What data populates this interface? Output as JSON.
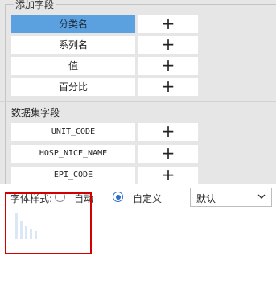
{
  "add_field": {
    "legend": "添加字段",
    "rows": [
      {
        "label": "分类名",
        "add": "+"
      },
      {
        "label": "系列名",
        "add": "+"
      },
      {
        "label": "值",
        "add": "+"
      },
      {
        "label": "百分比",
        "add": "+"
      }
    ]
  },
  "dataset": {
    "title": "数据集字段",
    "rows": [
      {
        "label": "UNIT_CODE",
        "add": "+"
      },
      {
        "label": "HOSP_NICE_NAME",
        "add": "+"
      },
      {
        "label": "EPI_CODE",
        "add": "+"
      }
    ]
  },
  "font_style": {
    "label": "字体样式:",
    "options": [
      "自动",
      "自定义"
    ],
    "selected": "自定义",
    "select_value": "默认"
  },
  "colors": {
    "selected_row": "#5ba1e0",
    "panel_bg": "#e6e6e6",
    "highlight_border": "#d40000",
    "radio_accent": "#2b6ec9"
  },
  "icons": {
    "add": "plus-icon",
    "dropdown": "chevron-down-icon"
  }
}
